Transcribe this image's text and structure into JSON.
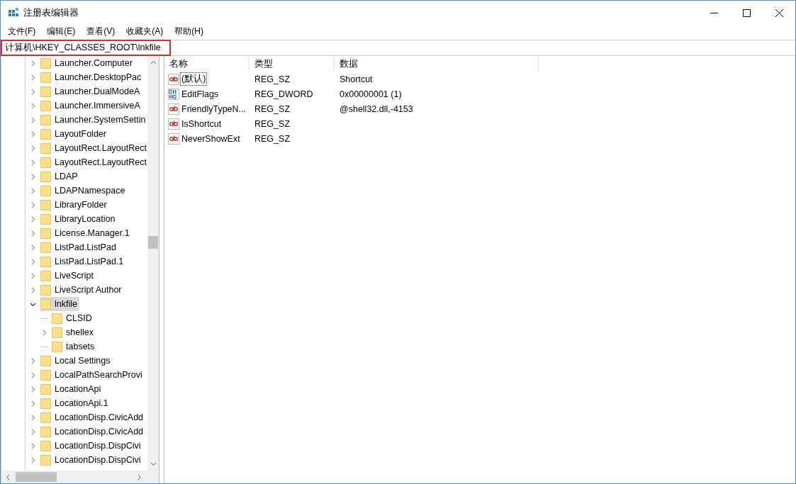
{
  "window": {
    "title": "注册表编辑器"
  },
  "menu": [
    {
      "label": "文件(F)"
    },
    {
      "label": "编辑(E)"
    },
    {
      "label": "查看(V)"
    },
    {
      "label": "收藏夹(A)"
    },
    {
      "label": "帮助(H)"
    }
  ],
  "address": {
    "value": "计算机\\HKEY_CLASSES_ROOT\\lnkfile",
    "highlighted": true
  },
  "tree": [
    {
      "label": "Launcher.Computer",
      "expandable": true,
      "expanded": false,
      "selected": false
    },
    {
      "label": "Launcher.DesktopPac",
      "expandable": true,
      "expanded": false,
      "selected": false
    },
    {
      "label": "Launcher.DualModeA",
      "expandable": true,
      "expanded": false,
      "selected": false
    },
    {
      "label": "Launcher.ImmersiveA",
      "expandable": true,
      "expanded": false,
      "selected": false
    },
    {
      "label": "Launcher.SystemSettin",
      "expandable": true,
      "expanded": false,
      "selected": false
    },
    {
      "label": "LayoutFolder",
      "expandable": true,
      "expanded": false,
      "selected": false
    },
    {
      "label": "LayoutRect.LayoutRect",
      "expandable": true,
      "expanded": false,
      "selected": false
    },
    {
      "label": "LayoutRect.LayoutRect",
      "expandable": true,
      "expanded": false,
      "selected": false
    },
    {
      "label": "LDAP",
      "expandable": true,
      "expanded": false,
      "selected": false
    },
    {
      "label": "LDAPNamespace",
      "expandable": true,
      "expanded": false,
      "selected": false
    },
    {
      "label": "LibraryFolder",
      "expandable": true,
      "expanded": false,
      "selected": false
    },
    {
      "label": "LibraryLocation",
      "expandable": true,
      "expanded": false,
      "selected": false
    },
    {
      "label": "License.Manager.1",
      "expandable": true,
      "expanded": false,
      "selected": false
    },
    {
      "label": "ListPad.ListPad",
      "expandable": true,
      "expanded": false,
      "selected": false
    },
    {
      "label": "ListPad.ListPad.1",
      "expandable": true,
      "expanded": false,
      "selected": false
    },
    {
      "label": "LiveScript",
      "expandable": true,
      "expanded": false,
      "selected": false
    },
    {
      "label": "LiveScript Author",
      "expandable": true,
      "expanded": false,
      "selected": false
    },
    {
      "label": "lnkfile",
      "expandable": true,
      "expanded": true,
      "selected": true,
      "children": [
        {
          "label": "CLSID",
          "expandable": false,
          "selected": false
        },
        {
          "label": "shellex",
          "expandable": true,
          "expanded": false,
          "selected": false
        },
        {
          "label": "tabsets",
          "expandable": false,
          "selected": false
        }
      ]
    },
    {
      "label": "Local Settings",
      "expandable": true,
      "expanded": false,
      "selected": false
    },
    {
      "label": "LocalPathSearchProvi",
      "expandable": true,
      "expanded": false,
      "selected": false
    },
    {
      "label": "LocationApi",
      "expandable": true,
      "expanded": false,
      "selected": false
    },
    {
      "label": "LocationApi.1",
      "expandable": true,
      "expanded": false,
      "selected": false
    },
    {
      "label": "LocationDisp.CivicAdd",
      "expandable": true,
      "expanded": false,
      "selected": false
    },
    {
      "label": "LocationDisp.CivicAdd",
      "expandable": true,
      "expanded": false,
      "selected": false
    },
    {
      "label": "LocationDisp.DispCivi",
      "expandable": true,
      "expanded": false,
      "selected": false
    },
    {
      "label": "LocationDisp.DispCivi",
      "expandable": true,
      "expanded": false,
      "selected": false
    }
  ],
  "values": {
    "columns": [
      "名称",
      "类型",
      "数据"
    ],
    "rows": [
      {
        "kind": "string",
        "name": "(默认)",
        "type": "REG_SZ",
        "data": "Shortcut",
        "focused": true
      },
      {
        "kind": "binary",
        "name": "EditFlags",
        "type": "REG_DWORD",
        "data": "0x00000001 (1)",
        "focused": false
      },
      {
        "kind": "string",
        "name": "FriendlyTypeN...",
        "type": "REG_SZ",
        "data": "@shell32.dll,-4153",
        "focused": false
      },
      {
        "kind": "string",
        "name": "IsShortcut",
        "type": "REG_SZ",
        "focused": false
      },
      {
        "kind": "string",
        "name": "NeverShowExt",
        "type": "REG_SZ",
        "focused": false
      }
    ]
  }
}
